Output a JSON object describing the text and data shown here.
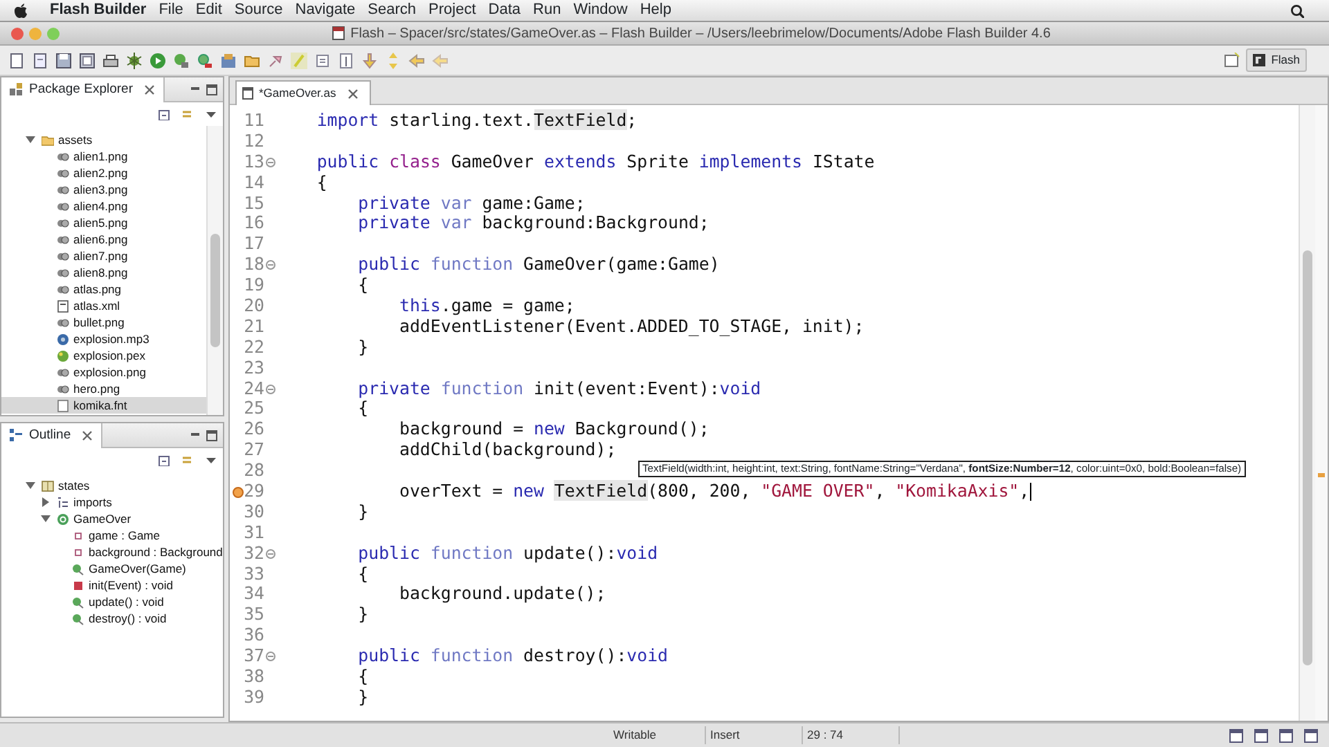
{
  "menu_bar": {
    "app_name": "Flash Builder",
    "items": [
      "File",
      "Edit",
      "Source",
      "Navigate",
      "Search",
      "Project",
      "Data",
      "Run",
      "Window",
      "Help"
    ]
  },
  "window": {
    "title": "Flash – Spacer/src/states/GameOver.as – Flash Builder – /Users/leebrimelow/Documents/Adobe Flash Builder 4.6"
  },
  "perspective": {
    "label": "Flash",
    "selected": true
  },
  "package_explorer": {
    "title": "Package Explorer",
    "tree": [
      {
        "label": "assets",
        "kind": "folder",
        "expanded": true,
        "children": [
          {
            "label": "alien1.png",
            "kind": "image",
            "selected": false
          },
          {
            "label": "alien2.png",
            "kind": "image",
            "selected": false
          },
          {
            "label": "alien3.png",
            "kind": "image",
            "selected": false
          },
          {
            "label": "alien4.png",
            "kind": "image",
            "selected": false
          },
          {
            "label": "alien5.png",
            "kind": "image",
            "selected": false
          },
          {
            "label": "alien6.png",
            "kind": "image",
            "selected": false
          },
          {
            "label": "alien7.png",
            "kind": "image",
            "selected": false
          },
          {
            "label": "alien8.png",
            "kind": "image",
            "selected": false
          },
          {
            "label": "atlas.png",
            "kind": "image",
            "selected": false
          },
          {
            "label": "atlas.xml",
            "kind": "xml",
            "selected": false
          },
          {
            "label": "bullet.png",
            "kind": "image",
            "selected": false
          },
          {
            "label": "explosion.mp3",
            "kind": "audio",
            "selected": false
          },
          {
            "label": "explosion.pex",
            "kind": "particle",
            "selected": false
          },
          {
            "label": "explosion.png",
            "kind": "image",
            "selected": false
          },
          {
            "label": "hero.png",
            "kind": "image",
            "selected": false
          },
          {
            "label": "komika.fnt",
            "kind": "file",
            "selected": true
          }
        ]
      }
    ]
  },
  "outline": {
    "title": "Outline",
    "tree": [
      {
        "label": "states",
        "kind": "package",
        "expanded": true,
        "children": [
          {
            "label": "imports",
            "kind": "imports",
            "expanded": false
          },
          {
            "label": "GameOver",
            "kind": "class",
            "expanded": true,
            "children": [
              {
                "label": "game : Game",
                "kind": "field"
              },
              {
                "label": "background : Background",
                "kind": "field"
              },
              {
                "label": "GameOver(Game)",
                "kind": "public_method"
              },
              {
                "label": "init(Event) : void",
                "kind": "private_method"
              },
              {
                "label": "update() : void",
                "kind": "public_method"
              },
              {
                "label": "destroy() : void",
                "kind": "public_method"
              }
            ]
          }
        ]
      }
    ]
  },
  "editor": {
    "tabs": [
      {
        "label": "*GameOver.as",
        "selected": true
      }
    ],
    "lines": [
      {
        "number": "11",
        "foldable": false,
        "error": false,
        "current": false,
        "segments": [
          {
            "kind": "keyword",
            "text": "    import"
          },
          {
            "kind": "plain",
            "text": " starling.text."
          },
          {
            "kind": "highlight",
            "text": "TextField"
          },
          {
            "kind": "plain",
            "text": ";"
          }
        ]
      },
      {
        "number": "12",
        "foldable": false,
        "error": false,
        "current": false
      },
      {
        "number": "13",
        "foldable": true,
        "error": false,
        "current": false,
        "segments": [
          {
            "kind": "keyword",
            "text": "    public "
          },
          {
            "kind": "class",
            "text": "class"
          },
          {
            "kind": "plain",
            "text": " GameOver "
          },
          {
            "kind": "keyword",
            "text": "extends"
          },
          {
            "kind": "plain",
            "text": " Sprite "
          },
          {
            "kind": "keyword",
            "text": "implements"
          },
          {
            "kind": "plain",
            "text": " IState"
          }
        ]
      },
      {
        "number": "14",
        "foldable": false,
        "error": false,
        "current": false,
        "segments": [
          {
            "kind": "plain",
            "text": "    {"
          }
        ]
      },
      {
        "number": "15",
        "foldable": false,
        "error": false,
        "current": false,
        "segments": [
          {
            "kind": "keyword",
            "text": "        private "
          },
          {
            "kind": "decl",
            "text": "var"
          },
          {
            "kind": "plain",
            "text": " game:Game;"
          }
        ]
      },
      {
        "number": "16",
        "foldable": false,
        "error": false,
        "current": false,
        "segments": [
          {
            "kind": "keyword",
            "text": "        private "
          },
          {
            "kind": "decl",
            "text": "var"
          },
          {
            "kind": "plain",
            "text": " background:Background;"
          }
        ]
      },
      {
        "number": "17",
        "foldable": false,
        "error": false,
        "current": false
      },
      {
        "number": "18",
        "foldable": true,
        "error": false,
        "current": false,
        "segments": [
          {
            "kind": "keyword",
            "text": "        public "
          },
          {
            "kind": "decl",
            "text": "function"
          },
          {
            "kind": "plain",
            "text": " GameOver(game:Game)"
          }
        ]
      },
      {
        "number": "19",
        "foldable": false,
        "error": false,
        "current": false,
        "segments": [
          {
            "kind": "plain",
            "text": "        {"
          }
        ]
      },
      {
        "number": "20",
        "foldable": false,
        "error": false,
        "current": false,
        "segments": [
          {
            "kind": "keyword",
            "text": "            this"
          },
          {
            "kind": "plain",
            "text": ".game = game;"
          }
        ]
      },
      {
        "number": "21",
        "foldable": false,
        "error": false,
        "current": false,
        "segments": [
          {
            "kind": "plain",
            "text": "            addEventListener(Event.ADDED_TO_STAGE, init);"
          }
        ]
      },
      {
        "number": "22",
        "foldable": false,
        "error": false,
        "current": false,
        "segments": [
          {
            "kind": "plain",
            "text": "        }"
          }
        ]
      },
      {
        "number": "23",
        "foldable": false,
        "error": false,
        "current": false
      },
      {
        "number": "24",
        "foldable": true,
        "error": false,
        "current": false,
        "segments": [
          {
            "kind": "keyword",
            "text": "        private "
          },
          {
            "kind": "decl",
            "text": "function"
          },
          {
            "kind": "plain",
            "text": " init(event:Event):"
          },
          {
            "kind": "keyword",
            "text": "void"
          }
        ]
      },
      {
        "number": "25",
        "foldable": false,
        "error": false,
        "current": false,
        "segments": [
          {
            "kind": "plain",
            "text": "        {"
          }
        ]
      },
      {
        "number": "26",
        "foldable": false,
        "error": false,
        "current": false,
        "segments": [
          {
            "kind": "plain",
            "text": "            background = "
          },
          {
            "kind": "keyword",
            "text": "new"
          },
          {
            "kind": "plain",
            "text": " Background();"
          }
        ]
      },
      {
        "number": "27",
        "foldable": false,
        "error": false,
        "current": false,
        "segments": [
          {
            "kind": "plain",
            "text": "            addChild(background);"
          }
        ]
      },
      {
        "number": "28",
        "foldable": false,
        "error": false,
        "current": false
      },
      {
        "number": "29",
        "foldable": false,
        "error": true,
        "current": true,
        "segments": [
          {
            "kind": "plain",
            "text": "            overText = "
          },
          {
            "kind": "keyword",
            "text": "new "
          },
          {
            "kind": "highlight",
            "text": "TextField"
          },
          {
            "kind": "plain",
            "text": "(800, 200, "
          },
          {
            "kind": "string",
            "text": "\"GAME OVER\""
          },
          {
            "kind": "plain",
            "text": ", "
          },
          {
            "kind": "string",
            "text": "\"KomikaAxis\""
          },
          {
            "kind": "plain",
            "text": ","
          }
        ]
      },
      {
        "number": "30",
        "foldable": false,
        "error": false,
        "current": false,
        "segments": [
          {
            "kind": "plain",
            "text": "        }"
          }
        ]
      },
      {
        "number": "31",
        "foldable": false,
        "error": false,
        "current": false
      },
      {
        "number": "32",
        "foldable": true,
        "error": false,
        "current": false,
        "segments": [
          {
            "kind": "keyword",
            "text": "        public "
          },
          {
            "kind": "decl",
            "text": "function"
          },
          {
            "kind": "plain",
            "text": " update():"
          },
          {
            "kind": "keyword",
            "text": "void"
          }
        ]
      },
      {
        "number": "33",
        "foldable": false,
        "error": false,
        "current": false,
        "segments": [
          {
            "kind": "plain",
            "text": "        {"
          }
        ]
      },
      {
        "number": "34",
        "foldable": false,
        "error": false,
        "current": false,
        "segments": [
          {
            "kind": "plain",
            "text": "            background.update();"
          }
        ]
      },
      {
        "number": "35",
        "foldable": false,
        "error": false,
        "current": false,
        "segments": [
          {
            "kind": "plain",
            "text": "        }"
          }
        ]
      },
      {
        "number": "36",
        "foldable": false,
        "error": false,
        "current": false
      },
      {
        "number": "37",
        "foldable": true,
        "error": false,
        "current": false,
        "segments": [
          {
            "kind": "keyword",
            "text": "        public "
          },
          {
            "kind": "decl",
            "text": "function"
          },
          {
            "kind": "plain",
            "text": " destroy():"
          },
          {
            "kind": "keyword",
            "text": "void"
          }
        ]
      },
      {
        "number": "38",
        "foldable": false,
        "error": false,
        "current": false,
        "segments": [
          {
            "kind": "plain",
            "text": "        {"
          }
        ]
      },
      {
        "number": "39",
        "foldable": false,
        "error": false,
        "current": false,
        "segments": [
          {
            "kind": "plain",
            "text": "        }"
          }
        ]
      }
    ],
    "tooltip": "TextField(width:int, height:int, text:String, fontName:String=\"Verdana\", **fontSize:Number=12**, color:uint=0x0, bold:Boolean=false)"
  },
  "status_bar": {
    "mode": "Writable",
    "insert_mode": "Insert",
    "position": "29 : 74"
  }
}
